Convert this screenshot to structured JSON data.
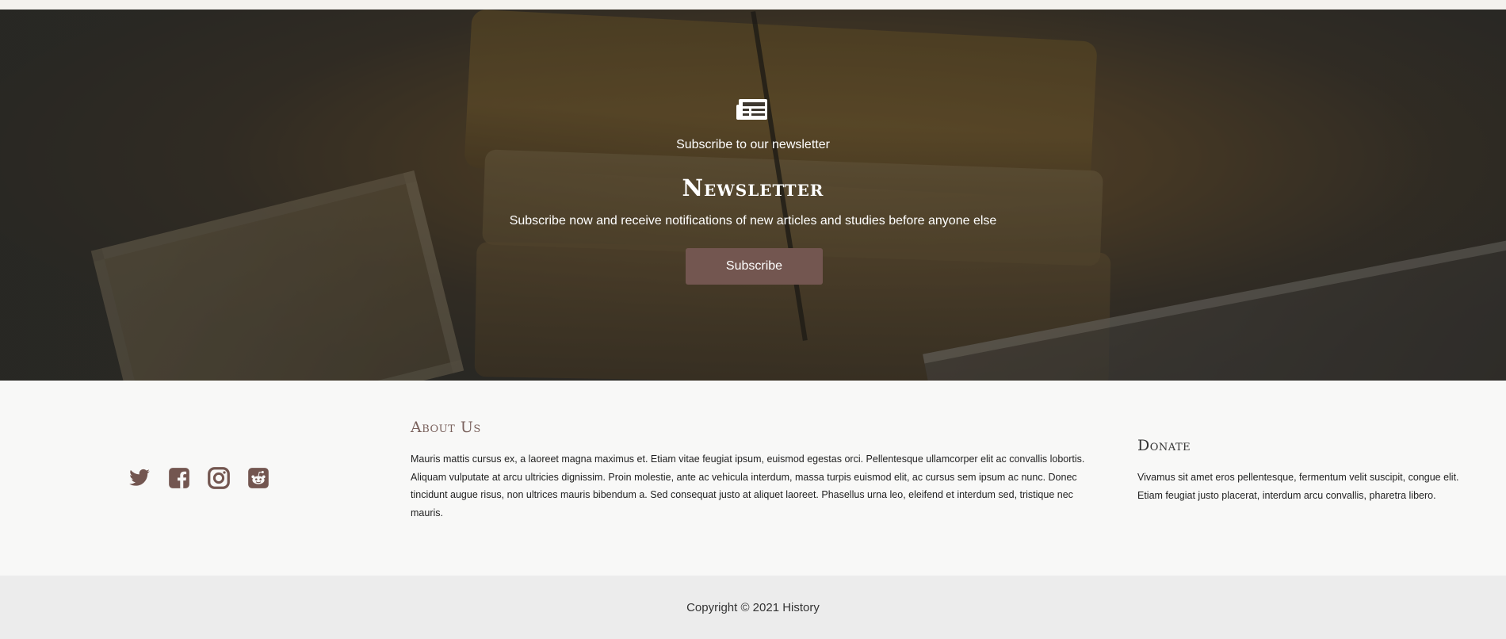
{
  "hero": {
    "icon": "newspaper-icon",
    "kicker": "Subscribe to our newsletter",
    "title": "Newsletter",
    "description": "Subscribe now and receive notifications of new articles and studies before anyone else",
    "button_label": "Subscribe",
    "button_color": "#735650"
  },
  "footer": {
    "social": [
      {
        "name": "twitter-icon"
      },
      {
        "name": "facebook-icon"
      },
      {
        "name": "instagram-icon"
      },
      {
        "name": "reddit-icon"
      }
    ],
    "social_color": "#735650",
    "about": {
      "heading": "About Us",
      "text": "Mauris mattis cursus ex, a laoreet magna maximus et. Etiam vitae feugiat ipsum, euismod egestas orci. Pellentesque ullamcorper elit ac convallis lobortis. Aliquam vulputate at arcu ultricies dignissim. Proin molestie, ante ac vehicula interdum, massa turpis euismod elit, ac cursus sem ipsum ac nunc. Donec tincidunt augue risus, non ultrices mauris bibendum a. Sed consequat justo at aliquet laoreet. Phasellus urna leo, eleifend et interdum sed, tristique nec mauris."
    },
    "donate": {
      "heading": "Donate",
      "text": "Vivamus sit amet eros pellentesque, fermentum velit suscipit, congue elit. Etiam feugiat justo placerat, interdum arcu convallis, pharetra libero."
    },
    "copyright": "Copyright © 2021 History"
  }
}
